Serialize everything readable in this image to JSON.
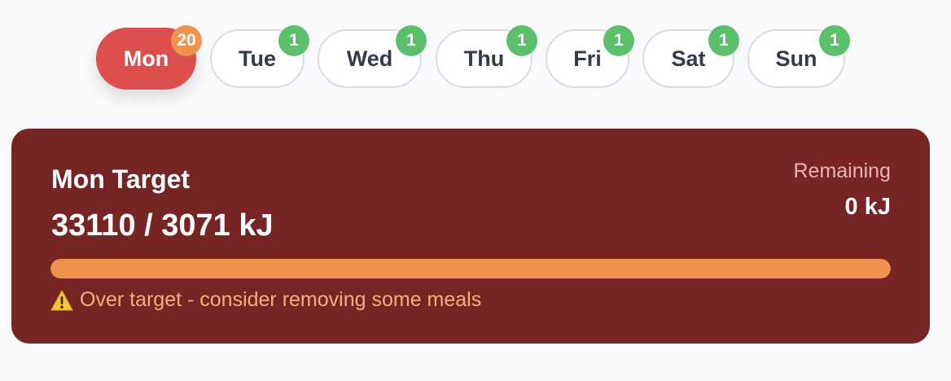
{
  "days": [
    {
      "label": "Mon",
      "badge": "20",
      "active": true
    },
    {
      "label": "Tue",
      "badge": "1",
      "active": false
    },
    {
      "label": "Wed",
      "badge": "1",
      "active": false
    },
    {
      "label": "Thu",
      "badge": "1",
      "active": false
    },
    {
      "label": "Fri",
      "badge": "1",
      "active": false
    },
    {
      "label": "Sat",
      "badge": "1",
      "active": false
    },
    {
      "label": "Sun",
      "badge": "1",
      "active": false
    }
  ],
  "colors": {
    "active_tab": "#dc4f4d",
    "active_badge": "#ef9450",
    "count_badge": "#5bbf6b",
    "card_bg": "#762424",
    "progress_fill": "#ef9450"
  },
  "target": {
    "title": "Mon Target",
    "progress_text": "33110 / 3071 kJ",
    "remaining_label": "Remaining",
    "remaining_value": "0 kJ",
    "progress_percent": 100,
    "warning_icon": "warning-icon",
    "warning_text": "Over target - consider removing some meals"
  }
}
